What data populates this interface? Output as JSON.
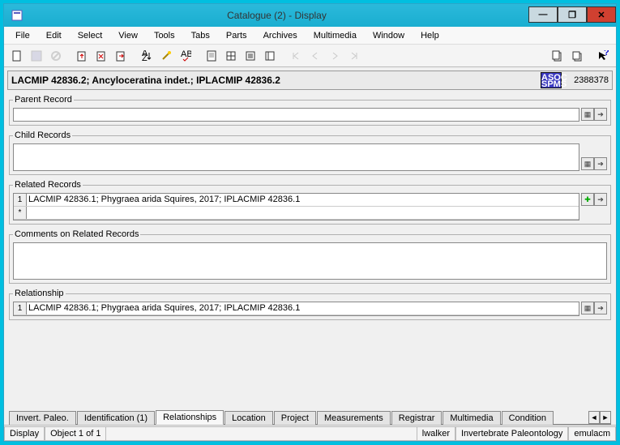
{
  "window": {
    "title": "Catalogue (2) - Display"
  },
  "menu": [
    "File",
    "Edit",
    "Select",
    "View",
    "Tools",
    "Tabs",
    "Parts",
    "Archives",
    "Multimedia",
    "Window",
    "Help"
  ],
  "header": {
    "record_title": "LACMIP 42836.2; Ancyloceratina indet.; IPLACMIP 42836.2",
    "badge_top": "ASOC",
    "badge_bot": "SPMS",
    "record_id": "2388378"
  },
  "sections": {
    "parent": {
      "legend": "Parent Record",
      "value": ""
    },
    "child": {
      "legend": "Child Records"
    },
    "related": {
      "legend": "Related Records",
      "rows": [
        {
          "num": "1",
          "text": "LACMIP 42836.1; Phygraea arida Squires, 2017; IPLACMIP 42836.1"
        },
        {
          "num": "*",
          "text": ""
        }
      ]
    },
    "comments": {
      "legend": "Comments on Related Records",
      "value": ""
    },
    "relationship": {
      "legend": "Relationship",
      "rows": [
        {
          "num": "1",
          "text": "LACMIP 42836.1; Phygraea arida Squires, 2017; IPLACMIP 42836.1"
        }
      ]
    }
  },
  "tabs": {
    "items": [
      "Invert. Paleo.",
      "Identification (1)",
      "Relationships",
      "Location",
      "Project",
      "Measurements",
      "Registrar",
      "Multimedia",
      "Condition"
    ],
    "active": 2
  },
  "status": {
    "mode": "Display",
    "pos": "Object 1 of 1",
    "user": "lwalker",
    "dept": "Invertebrate Paleontology",
    "sys": "emulacm"
  }
}
